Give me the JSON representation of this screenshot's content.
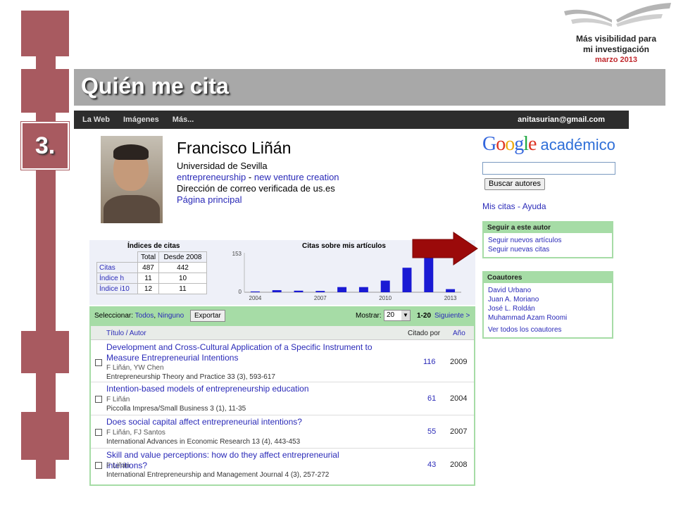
{
  "slide": {
    "brand_line1": "Más visibilidad para",
    "brand_line2": "mi investigación",
    "brand_date": "marzo 2013",
    "section_number": "3.",
    "title": "Quién me cita"
  },
  "gbar": {
    "nav": [
      "La Web",
      "Imágenes",
      "Más..."
    ],
    "email": "anitasurian@gmail.com"
  },
  "profile": {
    "name": "Francisco Liñán",
    "affiliation": "Universidad de Sevilla",
    "interests_1": "entrepreneurship",
    "interests_sep": " - ",
    "interests_2": "new venture creation",
    "email_verified": "Dirección de correo verificada de us.es",
    "homepage": "Página principal"
  },
  "sidebar": {
    "logo_google": "Google",
    "logo_academico": "académico",
    "search_button": "Buscar autores",
    "mis_citas": "Mis citas",
    "sep": " - ",
    "ayuda": "Ayuda",
    "follow_title": "Seguir a este autor",
    "follow_items": [
      "Seguir nuevos artículos",
      "Seguir nuevas citas"
    ],
    "coauthors_title": "Coautores",
    "coauthors": [
      "David Urbano",
      "Juan A. Moriano",
      "José L. Roldán",
      "Muhammad Azam Roomi"
    ],
    "coauthors_all": "Ver todos los coautores"
  },
  "citations": {
    "title": "Índices de citas",
    "headers": [
      "Total",
      "Desde 2008"
    ],
    "rows": [
      {
        "label": "Citas",
        "total": "487",
        "since": "442"
      },
      {
        "label": "Índice h",
        "total": "11",
        "since": "10"
      },
      {
        "label": "Índice i10",
        "total": "12",
        "since": "11"
      }
    ]
  },
  "chart_data": {
    "type": "bar",
    "title": "Citas sobre mis artículos",
    "x": [
      2004,
      2005,
      2006,
      2007,
      2008,
      2009,
      2010,
      2011,
      2012,
      2013
    ],
    "values": [
      3,
      8,
      6,
      5,
      20,
      20,
      45,
      95,
      140,
      12
    ],
    "xticks": [
      "2004",
      "2007",
      "2010",
      "2013"
    ],
    "yticks": [
      "153",
      "0"
    ],
    "ylim": [
      0,
      153
    ],
    "color": "#1a1ad4"
  },
  "articles": {
    "select_label": "Seleccionar:",
    "select_all": "Todos",
    "select_none": "Ninguno",
    "export": "Exportar",
    "show_label": "Mostrar:",
    "show_value": "20",
    "range": "1-20",
    "next": "Siguiente >",
    "col_title": "Título / Autor",
    "col_cited": "Citado por",
    "col_year": "Año",
    "items": [
      {
        "title": "Development and Cross-Cultural Application of a Specific Instrument to Measure Entrepreneurial Intentions",
        "authors": "F Liñán, YW Chen",
        "pub": "Entrepreneurship Theory and Practice 33 (3), 593-617",
        "cited": "116",
        "year": "2009"
      },
      {
        "title": "Intention-based models of entrepreneurship education",
        "authors": "F Liñán",
        "pub": "Piccolla Impresa/Small Business 3 (1), 11-35",
        "cited": "61",
        "year": "2004"
      },
      {
        "title": "Does social capital affect entrepreneurial intentions?",
        "authors": "F Liñán, FJ Santos",
        "pub": "International Advances in Economic Research 13 (4), 443-453",
        "cited": "55",
        "year": "2007"
      },
      {
        "title": "Skill and value perceptions: how do they affect entrepreneurial intentions?",
        "authors": "F Liñán",
        "pub": "International Entrepreneurship and Management Journal 4 (3), 257-272",
        "cited": "43",
        "year": "2008"
      }
    ]
  }
}
